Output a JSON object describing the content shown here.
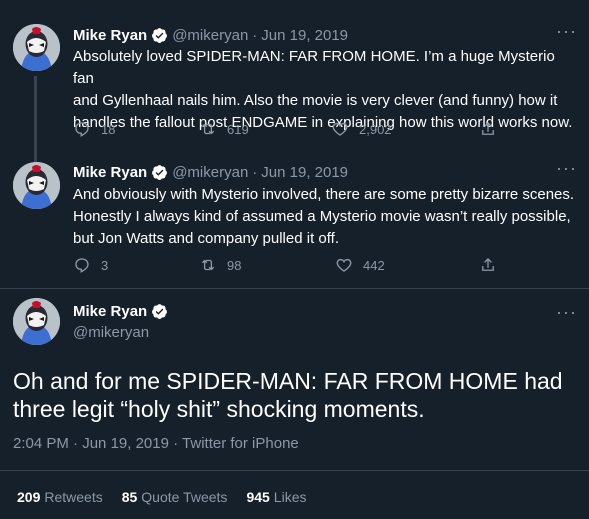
{
  "tweets": [
    {
      "name": "Mike Ryan",
      "handle": "@mikeryan",
      "separator": "·",
      "date": "Jun 19, 2019",
      "text": "Absolutely loved SPIDER-MAN: FAR FROM HOME. I’m a huge Mysterio fan\nand Gyllenhaal nails him. Also the movie is very clever (and funny) how it\nhandles the fallout post ENDGAME in explaining how this world works now.",
      "replies": "18",
      "retweets": "619",
      "likes": "2,902"
    },
    {
      "name": "Mike Ryan",
      "handle": "@mikeryan",
      "separator": "·",
      "date": "Jun 19, 2019",
      "text": "And obviously with Mysterio involved, there are some pretty bizarre scenes.\nHonestly I always kind of assumed a Mysterio movie wasn’t really possible,\nbut Jon Watts and company pulled it off.",
      "replies": "3",
      "retweets": "98",
      "likes": "442"
    }
  ],
  "main_tweet": {
    "name": "Mike Ryan",
    "handle": "@mikeryan",
    "text": "Oh and for me SPIDER-MAN: FAR FROM HOME had\nthree legit “holy shit” shocking moments.",
    "time": "2:04 PM",
    "separator": "·",
    "date": "Jun 19, 2019",
    "source": "Twitter for iPhone"
  },
  "stats": {
    "retweets_count": "209",
    "retweets_label": "Retweets",
    "quotes_count": "85",
    "quotes_label": "Quote Tweets",
    "likes_count": "945",
    "likes_label": "Likes"
  },
  "icons": {
    "more": "more-icon",
    "verified": "verified-badge-icon",
    "reply": "reply-icon",
    "retweet": "retweet-icon",
    "like": "like-icon",
    "share": "share-icon"
  },
  "colors": {
    "background": "#15202b",
    "secondary_text": "#8b98a5",
    "verified": "#ffffff",
    "divider": "#38444d"
  }
}
